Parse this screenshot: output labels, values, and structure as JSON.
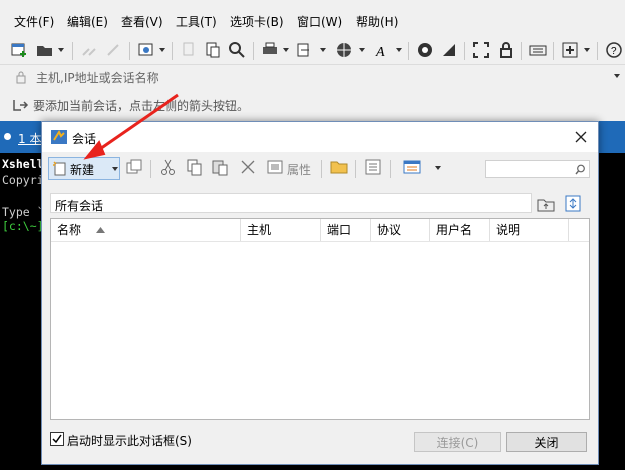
{
  "menu": {
    "items": [
      "文件(F)",
      "编辑(E)",
      "查看(V)",
      "工具(T)",
      "选项卡(B)",
      "窗口(W)",
      "帮助(H)"
    ]
  },
  "address_bar": {
    "placeholder": "主机,IP地址或会话名称"
  },
  "hint_bar": {
    "text": "要添加当前会话，点击左侧的箭头按钮。"
  },
  "tab": {
    "label": "1 本"
  },
  "terminal": {
    "lines": [
      "Xshell",
      "Copyri",
      "",
      "Type `",
      "[c:\\~]"
    ]
  },
  "dialog": {
    "title": "会话",
    "toolbar": {
      "new_label": "新建",
      "properties_label": "属性"
    },
    "folder_label": "所有会话",
    "columns": [
      "名称",
      "主机",
      "端口",
      "协议",
      "用户名",
      "说明"
    ],
    "rows": [],
    "startup_checkbox": {
      "label": "启动时显示此对话框(S)",
      "checked": true
    },
    "connect_button": "连接(C)",
    "close_button": "关闭"
  },
  "colors": {
    "tab_bar": "#1f6ab8",
    "terminal_bg": "#000000",
    "annotation_arrow": "#e8231d"
  },
  "icons": [
    "new-session-icon",
    "open-folder-icon",
    "cut-icon",
    "copy-icon",
    "paste-icon",
    "delete-icon",
    "properties-icon",
    "folder-icon",
    "view-icon",
    "search-icon",
    "close-icon"
  ]
}
